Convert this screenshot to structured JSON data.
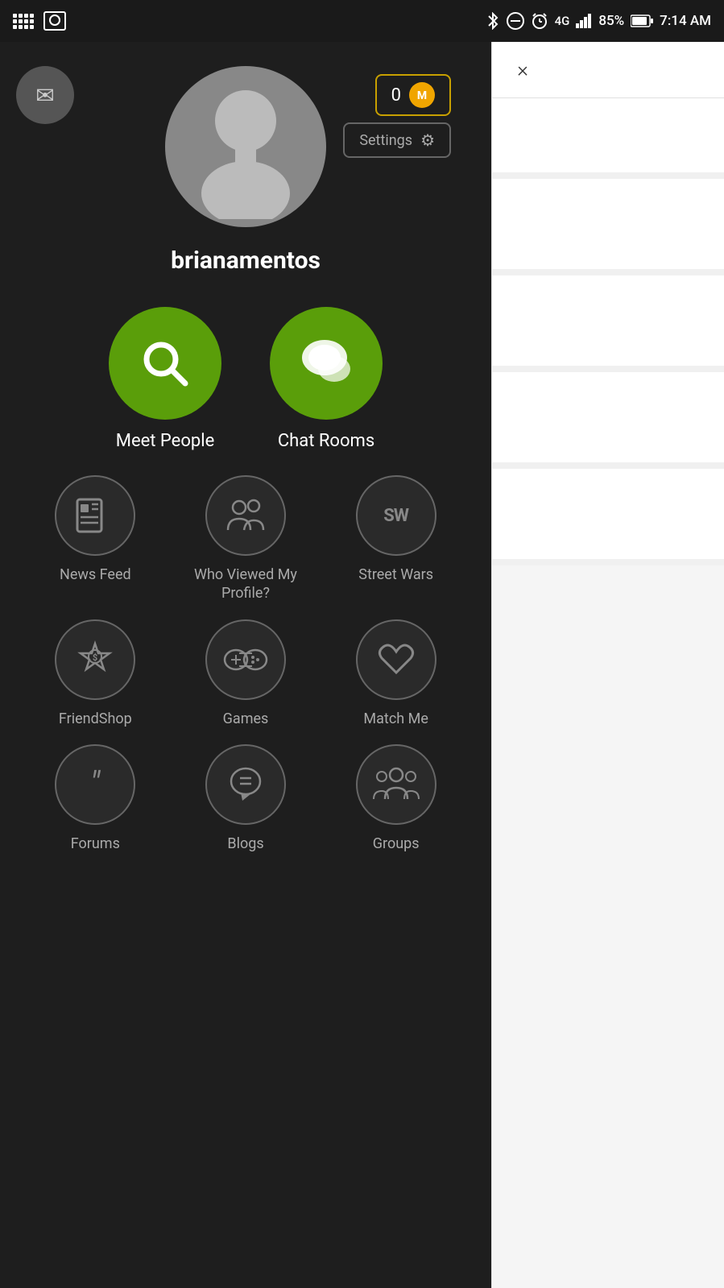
{
  "statusBar": {
    "time": "7:14 AM",
    "battery": "85%",
    "signal": "4G"
  },
  "profile": {
    "username": "brianamentos",
    "currency": "0",
    "settings_label": "Settings"
  },
  "largeMenuItems": [
    {
      "id": "meet-people",
      "label": "Meet People",
      "icon": "search"
    },
    {
      "id": "chat-rooms",
      "label": "Chat Rooms",
      "icon": "chat"
    }
  ],
  "smallMenuItems": [
    {
      "id": "news-feed",
      "label": "News Feed",
      "icon": "news"
    },
    {
      "id": "who-viewed",
      "label": "Who Viewed My Profile?",
      "icon": "group"
    },
    {
      "id": "street-wars",
      "label": "Street Wars",
      "icon": "sw"
    },
    {
      "id": "friendshop",
      "label": "FriendShop",
      "icon": "tag"
    },
    {
      "id": "games",
      "label": "Games",
      "icon": "games"
    },
    {
      "id": "match-me",
      "label": "Match Me",
      "icon": "heart"
    },
    {
      "id": "forums",
      "label": "Forums",
      "icon": "quote"
    },
    {
      "id": "blogs",
      "label": "Blogs",
      "icon": "blog"
    },
    {
      "id": "groups",
      "label": "Groups",
      "icon": "groups"
    }
  ],
  "slidePanel": {
    "close_label": "×"
  }
}
